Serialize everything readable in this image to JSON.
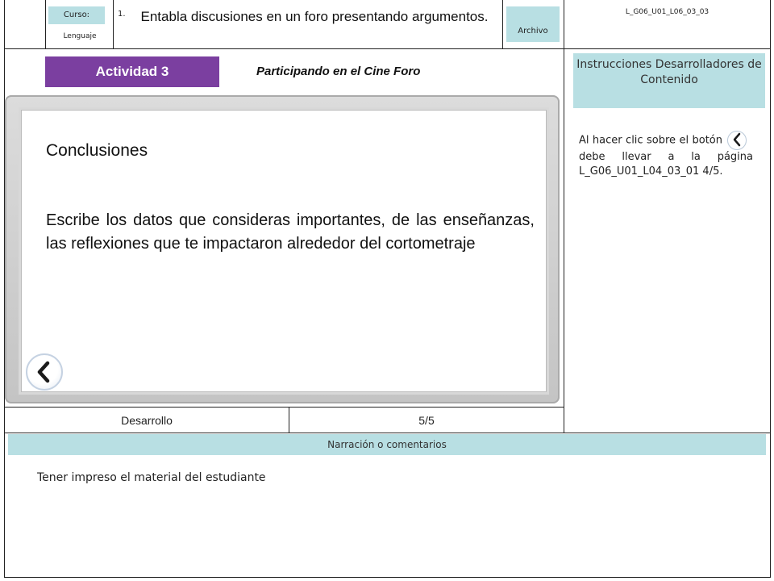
{
  "header": {
    "curso_label": "Curso:",
    "subject": "Lenguaje",
    "number": "1.",
    "title": "Entabla discusiones en un foro presentando argumentos.",
    "archivo_label": "Archivo",
    "code": "L_G06_U01_L06_03_03"
  },
  "activity": {
    "badge": "Actividad 3",
    "title": "Participando en el Cine Foro"
  },
  "slide": {
    "heading": "Conclusiones",
    "body": "Escribe los datos que consideras importantes, de las enseñanzas, las reflexiones que te impactaron alrededor del cortometraje",
    "back_icon": "chevron-left-icon"
  },
  "instructions": {
    "heading": "Instrucciones Desarrolladores de Contenido",
    "text_before": "Al hacer clic sobre el botón",
    "text_after": "debe llevar a la página L_G06_U01_L04_03_01 4/5."
  },
  "footer": {
    "section": "Desarrollo",
    "page": "5/5",
    "narration_label": "Narración o comentarios",
    "narration_text": "Tener impreso el material del estudiante"
  },
  "colors": {
    "accent_purple": "#7b3fa0",
    "label_teal": "#b8dfe3"
  }
}
